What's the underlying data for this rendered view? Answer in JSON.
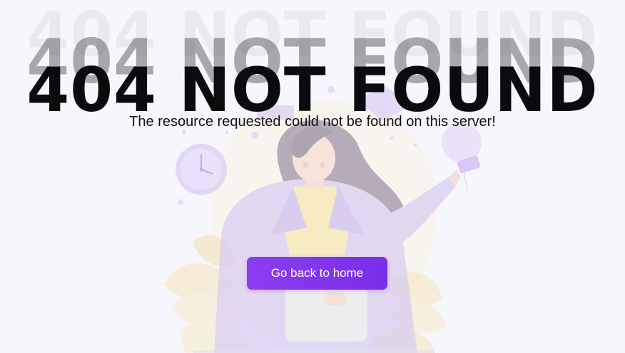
{
  "page": {
    "title": "404 NOT FOUND",
    "message": "The resource requested could not be found on this server!",
    "home_button_label": "Go back to home"
  },
  "theme": {
    "accent": "#7a2ee8",
    "background": "#f6f7fc",
    "title_color": "#0b0b0d"
  },
  "illustration": {
    "subject": "woman-pointing-at-lightbulb",
    "icons": [
      "clock-icon",
      "lightbulb-icon",
      "chat-bubble-icon",
      "tablet-icon",
      "leaf-icon"
    ]
  }
}
